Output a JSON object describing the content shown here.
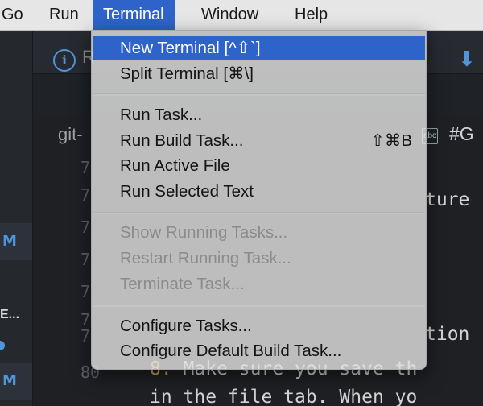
{
  "menubar": {
    "items": [
      {
        "label": "Go"
      },
      {
        "label": "Run"
      },
      {
        "label": "Terminal",
        "active": true
      },
      {
        "label": "Window"
      },
      {
        "label": "Help"
      }
    ]
  },
  "terminal_menu": {
    "group1": [
      {
        "label": "New Terminal",
        "shortcut": "[^⇧`]",
        "highlighted": true
      },
      {
        "label": "Split Terminal",
        "shortcut": "[⌘\\]"
      }
    ],
    "group2": [
      {
        "label": "Run Task..."
      },
      {
        "label": "Run Build Task...",
        "shortcut": "⇧⌘B"
      },
      {
        "label": "Run Active File"
      },
      {
        "label": "Run Selected Text"
      }
    ],
    "group3_disabled": [
      {
        "label": "Show Running Tasks..."
      },
      {
        "label": "Restart Running Task..."
      },
      {
        "label": "Terminate Task..."
      }
    ],
    "group4": [
      {
        "label": "Configure Tasks..."
      },
      {
        "label": "Configure Default Build Task..."
      }
    ]
  },
  "editor": {
    "tab_partial": "R",
    "breadcrumb_partial": "git-",
    "breadcrumb_hash": "#G",
    "breadcrumb_abc": "abc",
    "line_numbers": [
      "7",
      "7",
      "7",
      "7",
      "7",
      "7",
      "7",
      "80"
    ],
    "code_lines": [
      {
        "text": "ture"
      },
      {
        "text": "tion"
      },
      {
        "num": "8.",
        "text": " Make sure you save th"
      },
      {
        "text": "in the file tab. When yo"
      }
    ],
    "activity_badges": [
      "M",
      "M",
      "M"
    ],
    "activity_label": "E..."
  },
  "colors": {
    "menu_highlight": "#2e63c9",
    "menu_bg": "#e1e1e1",
    "editor_bg": "#1e2024",
    "accent_blue": "#4e96d9",
    "tab_accent": "#d9755e"
  }
}
